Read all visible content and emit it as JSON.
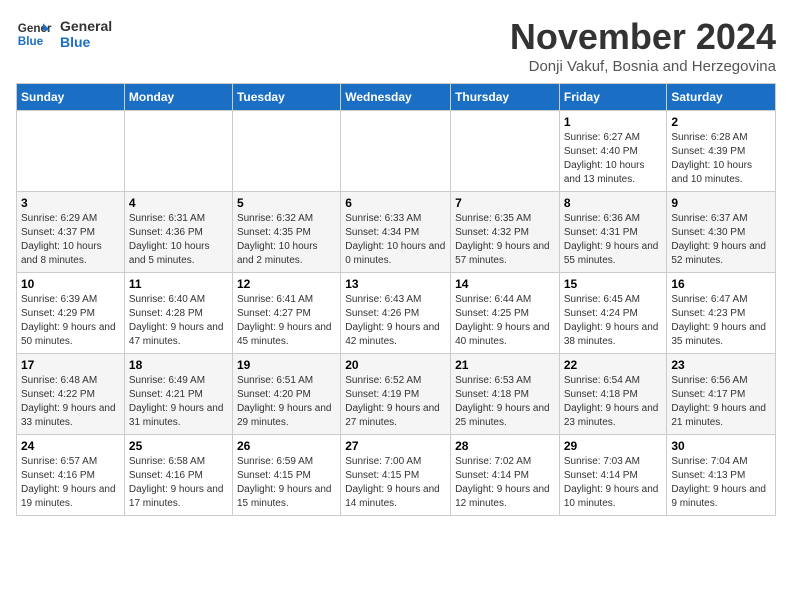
{
  "header": {
    "logo_line1": "General",
    "logo_line2": "Blue",
    "month_title": "November 2024",
    "subtitle": "Donji Vakuf, Bosnia and Herzegovina"
  },
  "weekdays": [
    "Sunday",
    "Monday",
    "Tuesday",
    "Wednesday",
    "Thursday",
    "Friday",
    "Saturday"
  ],
  "weeks": [
    [
      {
        "day": "",
        "info": ""
      },
      {
        "day": "",
        "info": ""
      },
      {
        "day": "",
        "info": ""
      },
      {
        "day": "",
        "info": ""
      },
      {
        "day": "",
        "info": ""
      },
      {
        "day": "1",
        "info": "Sunrise: 6:27 AM\nSunset: 4:40 PM\nDaylight: 10 hours and 13 minutes."
      },
      {
        "day": "2",
        "info": "Sunrise: 6:28 AM\nSunset: 4:39 PM\nDaylight: 10 hours and 10 minutes."
      }
    ],
    [
      {
        "day": "3",
        "info": "Sunrise: 6:29 AM\nSunset: 4:37 PM\nDaylight: 10 hours and 8 minutes."
      },
      {
        "day": "4",
        "info": "Sunrise: 6:31 AM\nSunset: 4:36 PM\nDaylight: 10 hours and 5 minutes."
      },
      {
        "day": "5",
        "info": "Sunrise: 6:32 AM\nSunset: 4:35 PM\nDaylight: 10 hours and 2 minutes."
      },
      {
        "day": "6",
        "info": "Sunrise: 6:33 AM\nSunset: 4:34 PM\nDaylight: 10 hours and 0 minutes."
      },
      {
        "day": "7",
        "info": "Sunrise: 6:35 AM\nSunset: 4:32 PM\nDaylight: 9 hours and 57 minutes."
      },
      {
        "day": "8",
        "info": "Sunrise: 6:36 AM\nSunset: 4:31 PM\nDaylight: 9 hours and 55 minutes."
      },
      {
        "day": "9",
        "info": "Sunrise: 6:37 AM\nSunset: 4:30 PM\nDaylight: 9 hours and 52 minutes."
      }
    ],
    [
      {
        "day": "10",
        "info": "Sunrise: 6:39 AM\nSunset: 4:29 PM\nDaylight: 9 hours and 50 minutes."
      },
      {
        "day": "11",
        "info": "Sunrise: 6:40 AM\nSunset: 4:28 PM\nDaylight: 9 hours and 47 minutes."
      },
      {
        "day": "12",
        "info": "Sunrise: 6:41 AM\nSunset: 4:27 PM\nDaylight: 9 hours and 45 minutes."
      },
      {
        "day": "13",
        "info": "Sunrise: 6:43 AM\nSunset: 4:26 PM\nDaylight: 9 hours and 42 minutes."
      },
      {
        "day": "14",
        "info": "Sunrise: 6:44 AM\nSunset: 4:25 PM\nDaylight: 9 hours and 40 minutes."
      },
      {
        "day": "15",
        "info": "Sunrise: 6:45 AM\nSunset: 4:24 PM\nDaylight: 9 hours and 38 minutes."
      },
      {
        "day": "16",
        "info": "Sunrise: 6:47 AM\nSunset: 4:23 PM\nDaylight: 9 hours and 35 minutes."
      }
    ],
    [
      {
        "day": "17",
        "info": "Sunrise: 6:48 AM\nSunset: 4:22 PM\nDaylight: 9 hours and 33 minutes."
      },
      {
        "day": "18",
        "info": "Sunrise: 6:49 AM\nSunset: 4:21 PM\nDaylight: 9 hours and 31 minutes."
      },
      {
        "day": "19",
        "info": "Sunrise: 6:51 AM\nSunset: 4:20 PM\nDaylight: 9 hours and 29 minutes."
      },
      {
        "day": "20",
        "info": "Sunrise: 6:52 AM\nSunset: 4:19 PM\nDaylight: 9 hours and 27 minutes."
      },
      {
        "day": "21",
        "info": "Sunrise: 6:53 AM\nSunset: 4:18 PM\nDaylight: 9 hours and 25 minutes."
      },
      {
        "day": "22",
        "info": "Sunrise: 6:54 AM\nSunset: 4:18 PM\nDaylight: 9 hours and 23 minutes."
      },
      {
        "day": "23",
        "info": "Sunrise: 6:56 AM\nSunset: 4:17 PM\nDaylight: 9 hours and 21 minutes."
      }
    ],
    [
      {
        "day": "24",
        "info": "Sunrise: 6:57 AM\nSunset: 4:16 PM\nDaylight: 9 hours and 19 minutes."
      },
      {
        "day": "25",
        "info": "Sunrise: 6:58 AM\nSunset: 4:16 PM\nDaylight: 9 hours and 17 minutes."
      },
      {
        "day": "26",
        "info": "Sunrise: 6:59 AM\nSunset: 4:15 PM\nDaylight: 9 hours and 15 minutes."
      },
      {
        "day": "27",
        "info": "Sunrise: 7:00 AM\nSunset: 4:15 PM\nDaylight: 9 hours and 14 minutes."
      },
      {
        "day": "28",
        "info": "Sunrise: 7:02 AM\nSunset: 4:14 PM\nDaylight: 9 hours and 12 minutes."
      },
      {
        "day": "29",
        "info": "Sunrise: 7:03 AM\nSunset: 4:14 PM\nDaylight: 9 hours and 10 minutes."
      },
      {
        "day": "30",
        "info": "Sunrise: 7:04 AM\nSunset: 4:13 PM\nDaylight: 9 hours and 9 minutes."
      }
    ]
  ]
}
